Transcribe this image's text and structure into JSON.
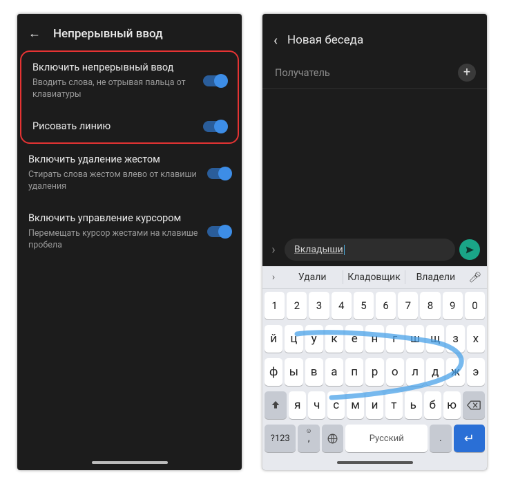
{
  "left": {
    "header_title": "Непрерывный ввод",
    "items": [
      {
        "title": "Включить непрерывный ввод",
        "desc": "Вводить слова, не отрывая пальца от клавиатуры",
        "on": true
      },
      {
        "title": "Рисовать линию",
        "desc": "",
        "on": true
      },
      {
        "title": "Включить удаление жестом",
        "desc": "Стирать слова жестом влево от клавиши удаления",
        "on": true
      },
      {
        "title": "Включить управление курсором",
        "desc": "Перемещать курсор жестами на клавише пробела",
        "on": true
      }
    ]
  },
  "right": {
    "header_title": "Новая беседа",
    "recipient_placeholder": "Получатель",
    "composer_value": "Вкладыши",
    "suggestions": [
      "Удали",
      "Кладовщик",
      "Владели"
    ],
    "keyboard": {
      "row_num": [
        "1",
        "2",
        "3",
        "4",
        "5",
        "6",
        "7",
        "8",
        "9",
        "0"
      ],
      "row2": [
        "й",
        "ц",
        "у",
        "к",
        "е",
        "н",
        "г",
        "ш",
        "щ",
        "з",
        "х"
      ],
      "row3": [
        "ф",
        "ы",
        "в",
        "а",
        "п",
        "р",
        "о",
        "л",
        "д",
        "ж",
        "э"
      ],
      "row4_mid": [
        "я",
        "ч",
        "с",
        "м",
        "и",
        "т",
        "ь",
        "б",
        "ю"
      ],
      "space_label": "Русский",
      "switch_label": "?123"
    }
  }
}
